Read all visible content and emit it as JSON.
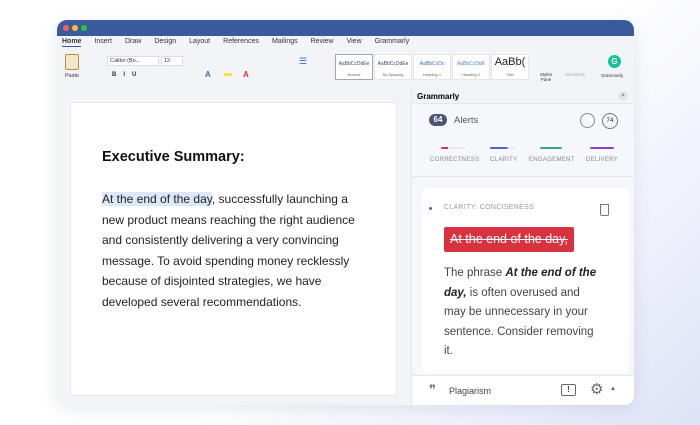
{
  "ribbon": {
    "tabs": [
      "Home",
      "Insert",
      "Draw",
      "Design",
      "Layout",
      "References",
      "Mailings",
      "Review",
      "View",
      "Grammarly"
    ],
    "font": "Calibri (Bo...",
    "size": "12",
    "paste": "Paste",
    "styles": [
      {
        "sample": "AaBbCcDdEe",
        "label": "Normal"
      },
      {
        "sample": "AaBbCcDdEe",
        "label": "No Spacing"
      },
      {
        "sample": "AaBbCcDc",
        "label": "Heading 1"
      },
      {
        "sample": "AaBbCcDdE",
        "label": "Heading 2"
      },
      {
        "sample": "AaBb(",
        "label": "Title"
      }
    ],
    "styles_pane": "Styles Pane",
    "sensitivity": "Sensitivity",
    "grammarly": "Grammarly"
  },
  "document": {
    "heading": "Executive Summary:",
    "highlight": "At the end of the day",
    "body": ", successfully launching a new product means reaching the right audience and consistently delivering a very convincing message. To avoid spending money recklessly because of disjointed strategies, we have developed several recommendations."
  },
  "panel": {
    "title": "Grammarly",
    "close": "×",
    "alerts_count": "64",
    "alerts_label": "Alerts",
    "score": "74",
    "categories": [
      {
        "label": "CORRECTNESS",
        "color": "#d23a4a"
      },
      {
        "label": "CLARITY",
        "color": "#4a64d0"
      },
      {
        "label": "ENGAGEMENT",
        "color": "#3aa87a"
      },
      {
        "label": "DELIVERY",
        "color": "#8a44c0"
      }
    ],
    "card": {
      "type": "CLARITY: CONCISENESS",
      "strike": "At the end of the day,",
      "pre": "The phrase ",
      "bold": "At the end of the day,",
      "post": "  is often overused and may be unnecessary in your sentence. Consider removing it.",
      "accent": "#d8323f"
    },
    "footer": {
      "plagiarism": "Plagiarism"
    }
  }
}
